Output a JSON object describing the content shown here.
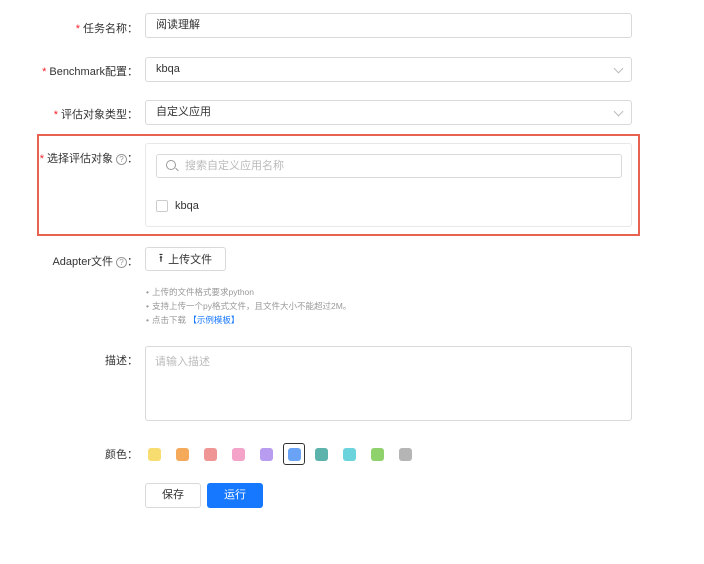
{
  "form": {
    "task_name": {
      "label": "任务名称",
      "value": "阅读理解"
    },
    "benchmark": {
      "label": "Benchmark配置",
      "value": "kbqa"
    },
    "eval_type": {
      "label": "评估对象类型",
      "value": "自定义应用"
    },
    "eval_target": {
      "label": "选择评估对象",
      "search_placeholder": "搜索自定义应用名称",
      "options": [
        {
          "label": "kbqa",
          "checked": false
        }
      ]
    },
    "adapter": {
      "label": "Adapter文件",
      "upload_label": "上传文件",
      "hints": [
        "上传的文件格式要求python",
        "支持上传一个py格式文件，且文件大小不能超过2M。",
        "点击下载"
      ],
      "template_link": "【示例模板】"
    },
    "description": {
      "label": "描述",
      "placeholder": "请输入描述"
    },
    "color": {
      "label": "颜色",
      "options": [
        "#f7dc6f",
        "#f5a95b",
        "#f09595",
        "#f4a3c9",
        "#b89cf0",
        "#6aa3f5",
        "#5cb3ab",
        "#6bd3db",
        "#8fd16a",
        "#b5b5b5"
      ],
      "selected_index": 5
    },
    "actions": {
      "save_label": "保存",
      "run_label": "运行"
    }
  },
  "colon": "：",
  "required_mark": "*",
  "help_mark": "?",
  "bullet": "•",
  "icons": {
    "search": "search-icon",
    "upload": "upload-icon",
    "select": "chevron-down-icon",
    "help": "question-circle-icon"
  },
  "colors": {
    "highlight": "#e8634f",
    "primary": "#1677ff",
    "required": "#f5222d"
  }
}
